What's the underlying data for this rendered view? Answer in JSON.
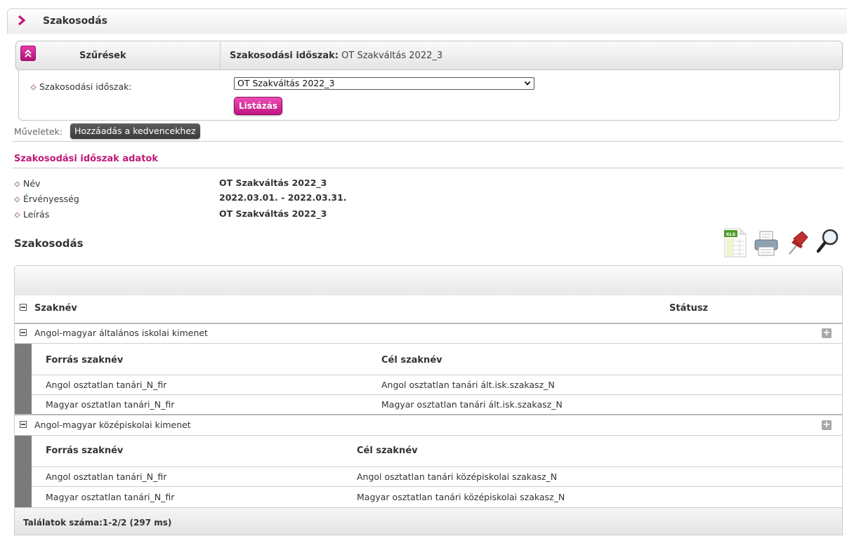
{
  "page": {
    "title": "Szakosodás"
  },
  "filter": {
    "header_title": "Szűrések",
    "summary_label": "Szakosodási időszak:",
    "summary_value": "OT Szakváltás 2022_3",
    "field_label": "Szakosodási időszak:",
    "select_value": "OT Szakváltás 2022_3",
    "list_button": "Listázás"
  },
  "actions": {
    "label": "Műveletek:",
    "favorite_button": "Hozzáadás a kedvencekhez"
  },
  "details": {
    "title": "Szakosodási időszak adatok",
    "rows": [
      {
        "label": "Név",
        "value": "OT Szakváltás 2022_3"
      },
      {
        "label": "Érvényesség",
        "value": "2022.03.01. - 2022.03.31."
      },
      {
        "label": "Leírás",
        "value": "OT Szakváltás 2022_3"
      }
    ]
  },
  "list": {
    "title": "Szakosodás",
    "tools": [
      {
        "icon": "xls-export-icon",
        "badge": "XLS"
      },
      {
        "icon": "printer-icon"
      },
      {
        "icon": "pin-icon"
      },
      {
        "icon": "magnifier-icon"
      }
    ]
  },
  "grid": {
    "col_szaknev": "Szaknév",
    "col_status": "Státusz",
    "groups": [
      {
        "name": "Angol-magyar általános iskolai kimenet",
        "col_source": "Forrás szaknév",
        "col_target": "Cél szaknév",
        "rows": [
          {
            "source": "Angol osztatlan tanári_N_fir",
            "target": "Angol osztatlan tanári ált.isk.szakasz_N"
          },
          {
            "source": "Magyar osztatlan tanári_N_fir",
            "target": "Magyar osztatlan tanári ált.isk.szakasz_N"
          }
        ]
      },
      {
        "name": "Angol-magyar középiskolai kimenet",
        "col_source": "Forrás szaknév",
        "col_target": "Cél szaknév",
        "rows": [
          {
            "source": "Angol osztatlan tanári_N_fir",
            "target": "Angol osztatlan tanári középiskolai szakasz_N"
          },
          {
            "source": "Magyar osztatlan tanári_N_fir",
            "target": "Magyar osztatlan tanári középiskolai szakasz_N"
          }
        ]
      }
    ],
    "footer": "Találatok száma:1-2/2 (297 ms)"
  },
  "colors": {
    "accent": "#c2187a",
    "button_pink": "#d3208f",
    "dark_button": "#4a4a4a",
    "diamond": "#c9a0c0"
  }
}
